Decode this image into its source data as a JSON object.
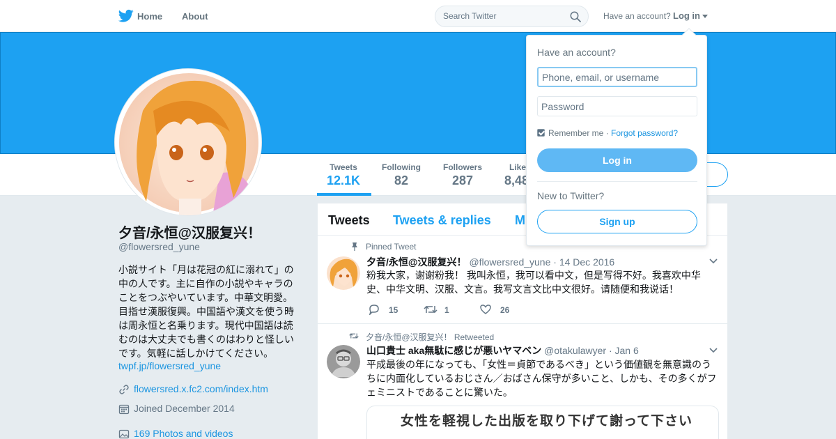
{
  "nav": {
    "home_label": "Home",
    "about_label": "About",
    "search_placeholder": "Search Twitter",
    "have_account": "Have an account?",
    "login_label": "Log in"
  },
  "profile": {
    "stats": [
      {
        "label": "Tweets",
        "value": "12.1K"
      },
      {
        "label": "Following",
        "value": "82"
      },
      {
        "label": "Followers",
        "value": "287"
      },
      {
        "label": "Like",
        "value": "8,48"
      }
    ],
    "name": "夕音/永恒@汉服复兴！",
    "handle": "@flowersred_yune",
    "bio_lines": [
      "小説サイト「月は花冠の紅に溺れて」の",
      "中の人です。主に自作の小説やキャラの",
      "ことをつぶやいています。中華文明愛。",
      "目指せ漢服復興。中国語や漢文を使う時",
      "は周永恒と名乗ります。現代中国語は読",
      "むのは大丈夫でも書くのはわりと怪しい",
      "です。気軽に話しかけてください。"
    ],
    "bio_link": "twpf.jp/flowersred_yune",
    "website": "flowersred.x.fc2.com/index.htm",
    "joined": "Joined December 2014",
    "photos": "169 Photos and videos"
  },
  "timeline": {
    "tabs": [
      "Tweets",
      "Tweets & replies",
      "M"
    ],
    "tweets": [
      {
        "context": "Pinned Tweet",
        "name": "夕音/永恒@汉服复兴！",
        "meta": "@flowersred_yune · 14 Dec 2016",
        "body_lines": [
          "粉我大家，谢谢粉我！ 我叫永恒，我可以看中文，但是写得不好。我喜欢中华",
          "史、中华文明、汉服、文言。我写文言文比中文很好。请随便和我说话！"
        ],
        "replies": "15",
        "retweets": "1",
        "likes": "26"
      },
      {
        "context": "夕音/永恒@汉服复兴！ Retweeted",
        "name": "山口貴士 aka無駄に感じが悪いヤマベン",
        "meta": "@otakulawyer · Jan 6",
        "body_lines": [
          "平成最後の年になっても、「女性＝貞節であるべき」という価値観を無意識のう",
          "ちに内面化しているおじさん／おばさん保守が多いこと、しかも、その多くがフ",
          "ェミニストであることに驚いた。"
        ],
        "card_text": "女性を軽視した出版を取り下げて謝って下さい"
      }
    ]
  },
  "login_dropdown": {
    "title": "Have an account?",
    "username_placeholder": "Phone, email, or username",
    "password_placeholder": "Password",
    "remember": "Remember me",
    "forgot": "Forgot password?",
    "login_button": "Log in",
    "new_to_twitter": "New to Twitter?",
    "signup_button": "Sign up"
  },
  "colors": {
    "brand_blue": "#1da1f2",
    "link_blue": "#1b95e0",
    "background": "#e6ecf0",
    "muted_text": "#657786"
  }
}
